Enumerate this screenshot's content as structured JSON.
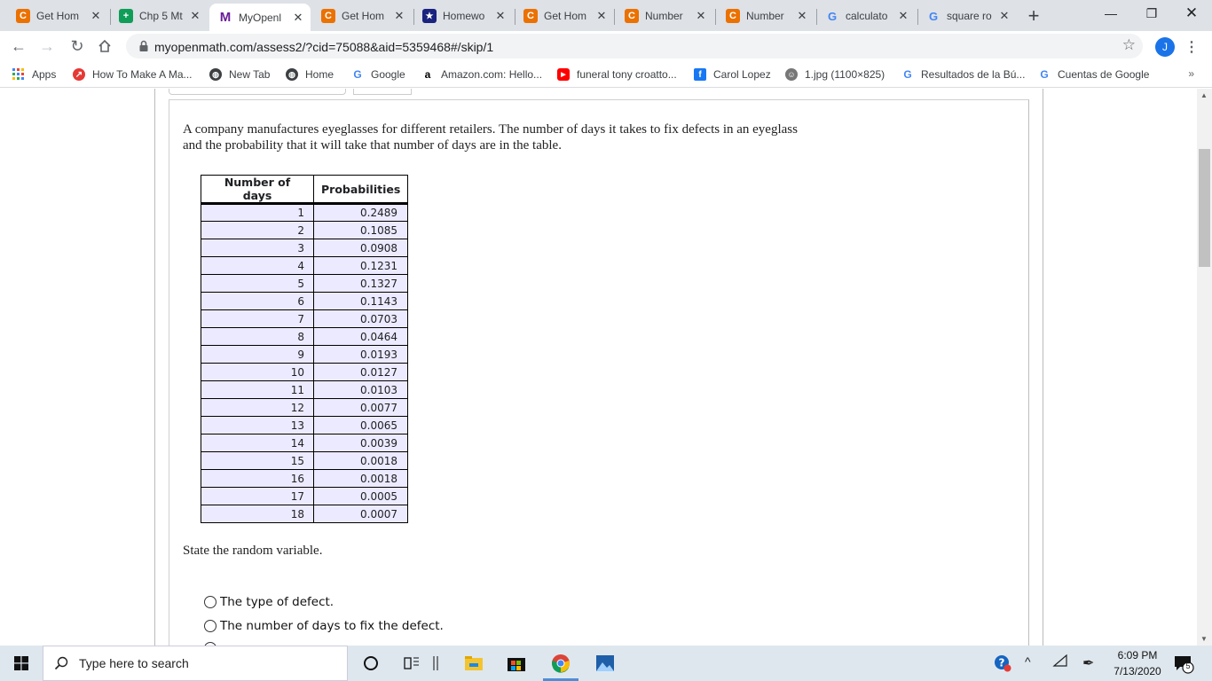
{
  "browser": {
    "tabs": [
      {
        "title": "Get Hom",
        "icon": "chegg-icon"
      },
      {
        "title": "Chp 5 Mt",
        "icon": "sheets-icon"
      },
      {
        "title": "MyOpenl",
        "icon": "myopenmath-icon"
      },
      {
        "title": "Get Hom",
        "icon": "chegg-icon"
      },
      {
        "title": "Homewo",
        "icon": "star-icon"
      },
      {
        "title": "Get Hom",
        "icon": "chegg-icon"
      },
      {
        "title": "Number",
        "icon": "chegg-icon"
      },
      {
        "title": "Number",
        "icon": "chegg-icon"
      },
      {
        "title": "calculato",
        "icon": "google-icon"
      },
      {
        "title": "square ro",
        "icon": "google-icon"
      }
    ],
    "url": "myopenmath.com/assess2/?cid=75088&aid=5359468#/skip/1",
    "profile_initial": "J",
    "bookmarks": [
      {
        "label": "Apps",
        "icon": "apps-grid-icon"
      },
      {
        "label": "How To Make A Ma...",
        "icon": "trend-icon"
      },
      {
        "label": "New Tab",
        "icon": "globe-icon"
      },
      {
        "label": "Home",
        "icon": "globe-icon"
      },
      {
        "label": "Google",
        "icon": "google-icon"
      },
      {
        "label": "Amazon.com: Hello...",
        "icon": "amazon-icon"
      },
      {
        "label": "funeral tony croatto...",
        "icon": "youtube-icon"
      },
      {
        "label": "Carol Lopez",
        "icon": "facebook-icon"
      },
      {
        "label": "1.jpg (1100×825)",
        "icon": "image-icon"
      },
      {
        "label": "Resultados de la Bú...",
        "icon": "google-icon"
      },
      {
        "label": "Cuentas de Google",
        "icon": "google-icon"
      }
    ],
    "bookmarks_more": "»"
  },
  "question": {
    "prompt": "A company manufactures eyeglasses for different retailers. The number of days it takes to fix defects in an eyeglass and the probability that it will take that number of days are in the table.",
    "table": {
      "headers": [
        "Number of days",
        "Probabilities"
      ],
      "rows": [
        [
          "1",
          "0.2489"
        ],
        [
          "2",
          "0.1085"
        ],
        [
          "3",
          "0.0908"
        ],
        [
          "4",
          "0.1231"
        ],
        [
          "5",
          "0.1327"
        ],
        [
          "6",
          "0.1143"
        ],
        [
          "7",
          "0.0703"
        ],
        [
          "8",
          "0.0464"
        ],
        [
          "9",
          "0.0193"
        ],
        [
          "10",
          "0.0127"
        ],
        [
          "11",
          "0.0103"
        ],
        [
          "12",
          "0.0077"
        ],
        [
          "13",
          "0.0065"
        ],
        [
          "14",
          "0.0039"
        ],
        [
          "15",
          "0.0018"
        ],
        [
          "16",
          "0.0018"
        ],
        [
          "17",
          "0.0005"
        ],
        [
          "18",
          "0.0007"
        ]
      ]
    },
    "sub_prompt": "State the random variable.",
    "options": [
      "The type of defect.",
      "The number of days to fix the defect."
    ]
  },
  "taskbar": {
    "search_placeholder": "Type here to search",
    "time": "6:09 PM",
    "date": "7/13/2020",
    "notification_count": "5"
  },
  "colors": {
    "chegg": "#eb7100",
    "sheets": "#0f9d58",
    "myopenmath": "#6a1b9a",
    "table_cell": "#eceaff",
    "chrome_tabstrip": "#dee1e6"
  }
}
